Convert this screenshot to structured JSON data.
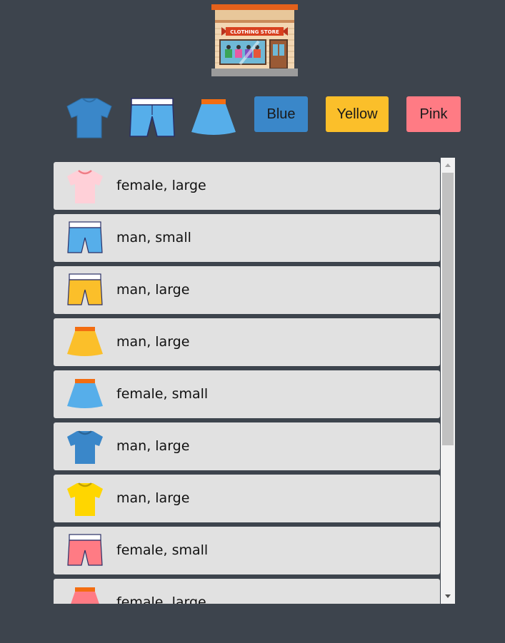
{
  "store": {
    "sign_text": "CLOTHING STORE",
    "icon": "clothing-store-icon"
  },
  "filters": {
    "types": [
      {
        "name": "tshirt",
        "icon": "tshirt-icon",
        "color": "#3a87c9"
      },
      {
        "name": "shorts",
        "icon": "shorts-icon",
        "color": "#56aeea"
      },
      {
        "name": "skirt",
        "icon": "skirt-icon",
        "color": "#56aeea"
      }
    ],
    "colors": [
      {
        "label": "Blue",
        "color": "#3a87c9"
      },
      {
        "label": "Yellow",
        "color": "#fbbf2a"
      },
      {
        "label": "Pink",
        "color": "#ff7b84"
      }
    ]
  },
  "items": [
    {
      "type": "tshirt",
      "icon": "tshirt-icon",
      "color": "#ffd0d8",
      "label": "female, large"
    },
    {
      "type": "shorts",
      "icon": "shorts-icon",
      "color": "#56aeea",
      "label": "man, small"
    },
    {
      "type": "shorts",
      "icon": "shorts-icon",
      "color": "#fbbf2a",
      "label": "man, large"
    },
    {
      "type": "skirt",
      "icon": "skirt-icon",
      "color": "#fbbf2a",
      "label": "man, large"
    },
    {
      "type": "skirt",
      "icon": "skirt-icon",
      "color": "#56aeea",
      "label": "female, small"
    },
    {
      "type": "tshirt",
      "icon": "tshirt-icon",
      "color": "#3a87c9",
      "label": "man, large"
    },
    {
      "type": "tshirt",
      "icon": "tshirt-icon",
      "color": "#ffd600",
      "label": "man, large"
    },
    {
      "type": "shorts",
      "icon": "shorts-icon",
      "color": "#ff7b84",
      "label": "female, small"
    },
    {
      "type": "skirt",
      "icon": "skirt-icon",
      "color": "#ff7b84",
      "label": "female, large"
    }
  ],
  "scroll": {
    "position": 0
  }
}
